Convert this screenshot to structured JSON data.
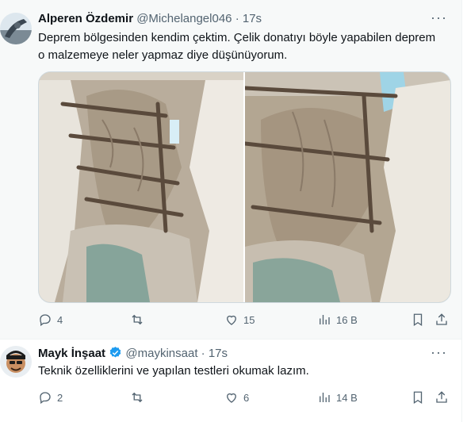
{
  "tweets": [
    {
      "display_name": "Alperen Özdemir",
      "handle": "@Michelangel046",
      "separator": "·",
      "time": "17s",
      "more": "···",
      "text_line1": "Deprem bölgesinden kendim çektim. Çelik donatıyı böyle yapabilen deprem",
      "text_line2": "o malzemeye neler yapmaz diye düşünüyorum.",
      "replies": "4",
      "retweets": "",
      "likes": "15",
      "views": "16 B"
    },
    {
      "display_name": "Mayk İnşaat",
      "handle": "@maykinsaat",
      "separator": "·",
      "time": "17s",
      "more": "···",
      "text_line1": "Teknik özelliklerini ve yapılan testleri okumak lazım.",
      "replies": "2",
      "retweets": "",
      "likes": "6",
      "views": "14 B"
    }
  ],
  "icons": {
    "reply": "reply-icon",
    "retweet": "retweet-icon",
    "like": "heart-icon",
    "views": "views-icon",
    "bookmark": "bookmark-icon",
    "share": "share-icon",
    "verified": "verified-badge-icon"
  },
  "colors": {
    "verified": "#1d9bf0",
    "muted": "#536471",
    "hover_bg": "#f7f9f9"
  }
}
